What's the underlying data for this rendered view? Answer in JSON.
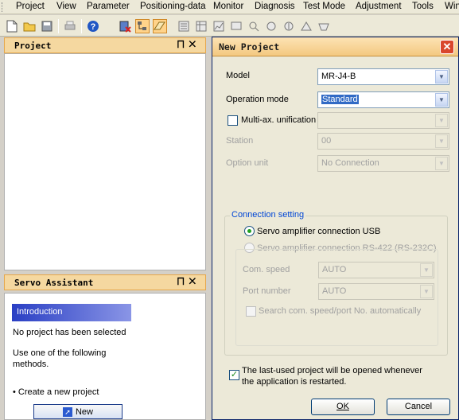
{
  "menu": [
    "Project",
    "View",
    "Parameter",
    "Positioning-data",
    "Monitor",
    "Diagnosis",
    "Test Mode",
    "Adjustment",
    "Tools",
    "Win"
  ],
  "project_panel": {
    "title": "Project"
  },
  "assistant_panel": {
    "title": "Servo Assistant",
    "intro_header": "Introduction",
    "no_project": "No project has been selected",
    "use_line1": "Use one of the following",
    "use_line2": "methods.",
    "create_item": "• Create a new project",
    "new_button": "New"
  },
  "dialog": {
    "title": "New Project",
    "model_label": "Model",
    "model_value": "MR-J4-B",
    "opmode_label": "Operation mode",
    "opmode_value": "Standard",
    "multi_label": "Multi-ax. unification",
    "station_label": "Station",
    "station_value": "00",
    "option_label": "Option unit",
    "option_value": "No Connection",
    "conn_group": "Connection setting",
    "usb_label": "Servo amplifier connection USB",
    "rs_label": "Servo amplifier connection RS-422 (RS-232C)",
    "com_speed_label": "Com. speed",
    "com_speed_value": "AUTO",
    "port_label": "Port number",
    "port_value": "AUTO",
    "search_label": "Search com. speed/port No. automatically",
    "lastused_line1": "The last-used project will be opened whenever",
    "lastused_line2": "the application is restarted.",
    "ok_label": "OK",
    "cancel_label": "Cancel"
  },
  "colors": {
    "panel_title": "#f5d8a0",
    "intro_header": "#2a3fc4",
    "selection": "#316ac5",
    "group_title": "#0046d5"
  }
}
